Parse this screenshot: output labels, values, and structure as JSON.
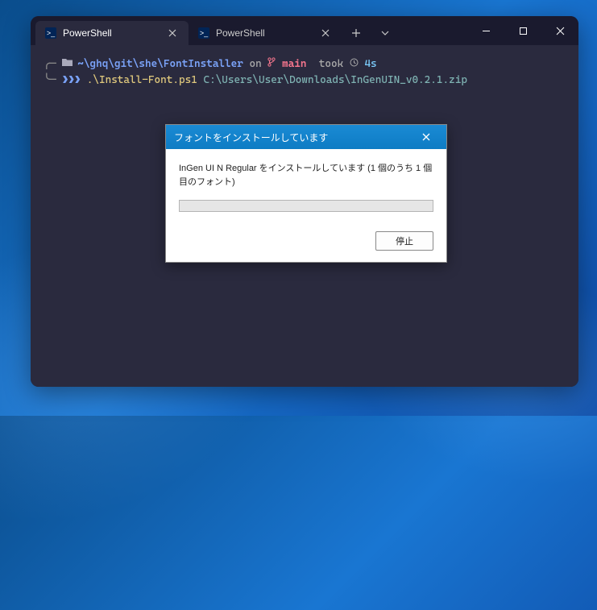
{
  "tabs": [
    {
      "label": "PowerShell"
    },
    {
      "label": "PowerShell"
    }
  ],
  "prompt": {
    "path": "~\\ghq\\git\\she\\FontInstaller",
    "on": "on",
    "branch": "main",
    "took": "took",
    "duration": "4s"
  },
  "command": {
    "arrows": "❯❯❯",
    "script": ".\\Install-Font.ps1",
    "arg": "C:\\Users\\User\\Downloads\\InGenUIN_v0.2.1.zip"
  },
  "dialog": {
    "title": "フォントをインストールしています",
    "message": "InGen UI N Regular をインストールしています (1 個のうち 1 個目のフォント)",
    "button": "停止"
  }
}
